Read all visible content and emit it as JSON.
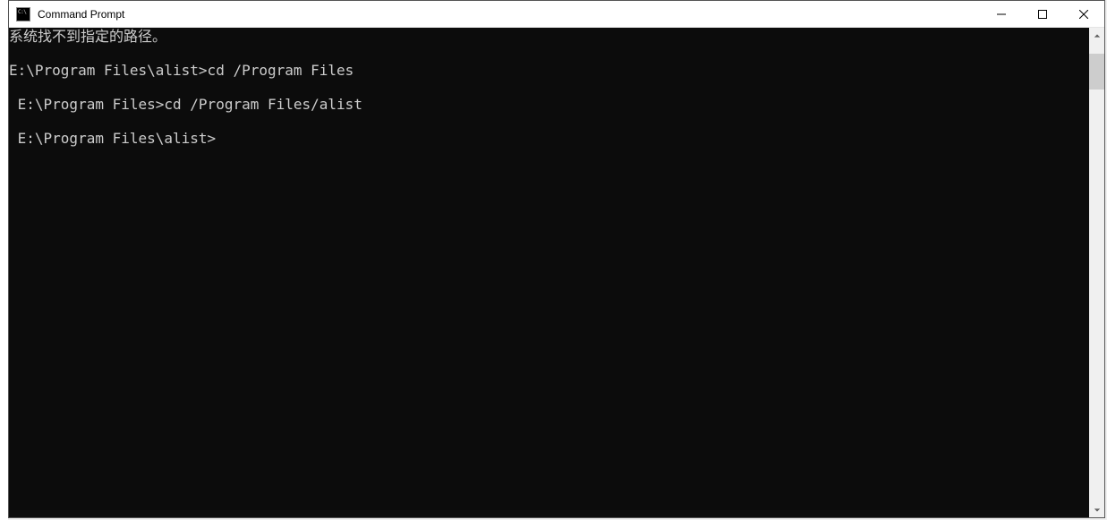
{
  "window": {
    "title": "Command Prompt"
  },
  "terminal": {
    "lines": [
      "系统找不到指定的路径。",
      "",
      "E:\\Program Files\\alist>cd /Program Files",
      "",
      " E:\\Program Files>cd /Program Files/alist",
      "",
      " E:\\Program Files\\alist>",
      ""
    ]
  }
}
